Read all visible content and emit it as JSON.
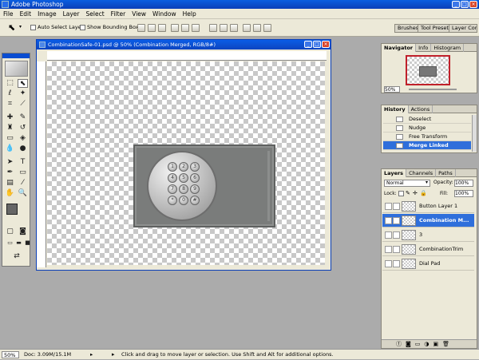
{
  "app": {
    "title": "Adobe Photoshop"
  },
  "menu": [
    "File",
    "Edit",
    "Image",
    "Layer",
    "Select",
    "Filter",
    "View",
    "Window",
    "Help"
  ],
  "options": {
    "auto_select": "Auto Select Layer",
    "show_bounding": "Show Bounding Box"
  },
  "wells": {
    "brushes": "Brushes",
    "presets": "Tool Presets",
    "comps": "Layer Comps"
  },
  "document": {
    "title": "CombinationSafe-01.psd @ 50% (Combination Merged, RGB/8#)"
  },
  "keypad": [
    "1",
    "2",
    "3",
    "4",
    "5",
    "6",
    "7",
    "8",
    "9",
    "*",
    "0",
    "#"
  ],
  "navigator": {
    "tabs": [
      "Navigator",
      "Info",
      "Histogram"
    ],
    "zoom": "50%"
  },
  "history": {
    "tabs": [
      "History",
      "Actions"
    ],
    "items": [
      "Deselect",
      "Nudge",
      "Free Transform",
      "Merge Linked"
    ]
  },
  "layers": {
    "tabs": [
      "Layers",
      "Channels",
      "Paths"
    ],
    "blend": "Normal",
    "opacity_label": "Opacity:",
    "opacity": "100%",
    "lock_label": "Lock:",
    "fill_label": "Fill:",
    "fill": "100%",
    "items": [
      "Button Layer 1",
      "Combination M...",
      "3",
      "CombinationTrim",
      "Dial Pad"
    ]
  },
  "status": {
    "zoom": "50%",
    "doc": "Doc: 3.09M/15.1M",
    "hint": "Click and drag to move layer or selection.  Use Shift and Alt for additional options."
  }
}
